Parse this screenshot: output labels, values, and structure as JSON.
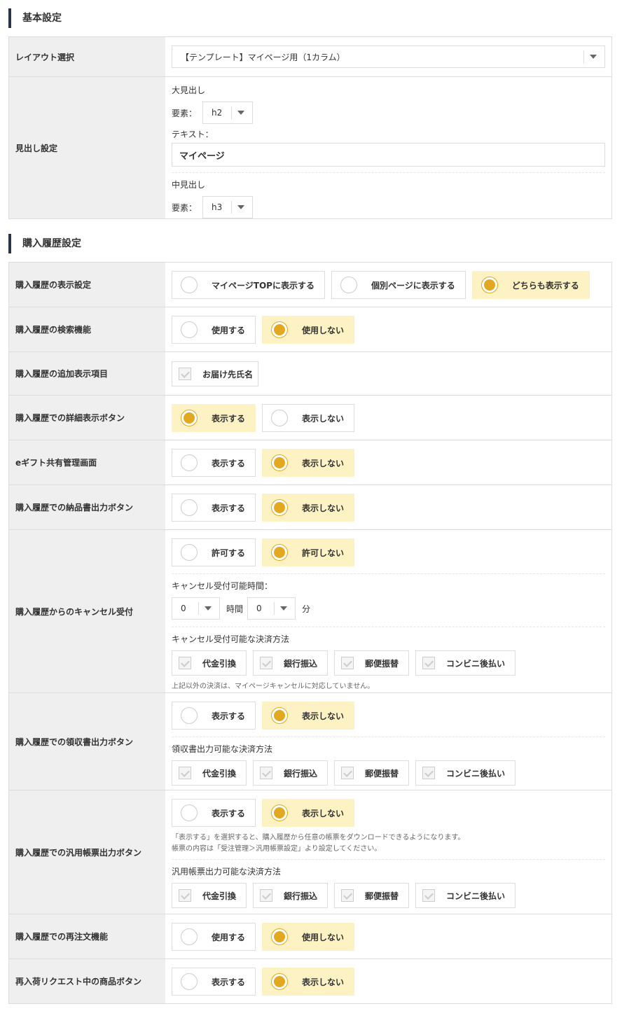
{
  "basic": {
    "title": "基本設定",
    "layout_label": "レイアウト選択",
    "layout_value": "【テンプレート】マイページ用（1カラム）",
    "heading_label": "見出し設定",
    "large_heading": "大見出し",
    "element_label": "要素：",
    "large_element": "h2",
    "text_label": "テキスト：",
    "large_text": "マイページ",
    "mid_heading": "中見出し",
    "mid_element": "h3"
  },
  "history": {
    "title": "購入履歴設定",
    "display_setting": {
      "label": "購入履歴の表示設定",
      "options": [
        "マイページTOPに表示する",
        "個別ページに表示する",
        "どちらも表示する"
      ]
    },
    "search": {
      "label": "購入履歴の検索機能",
      "options": [
        "使用する",
        "使用しない"
      ]
    },
    "additional": {
      "label": "購入履歴の追加表示項目",
      "checkbox": "お届け先氏名"
    },
    "detail_btn": {
      "label": "購入履歴での詳細表示ボタン",
      "options": [
        "表示する",
        "表示しない"
      ]
    },
    "egift": {
      "label": "eギフト共有管理画面",
      "options": [
        "表示する",
        "表示しない"
      ]
    },
    "delivery_btn": {
      "label": "購入履歴での納品書出力ボタン",
      "options": [
        "表示する",
        "表示しない"
      ]
    },
    "cancel": {
      "label": "購入履歴からのキャンセル受付",
      "options": [
        "許可する",
        "許可しない"
      ],
      "time_label": "キャンセル受付可能時間：",
      "hours": "0",
      "hours_unit": "時間",
      "minutes": "0",
      "minutes_unit": "分",
      "methods_label": "キャンセル受付可能な決済方法",
      "methods": [
        "代金引換",
        "銀行振込",
        "郵便振替",
        "コンビニ後払い"
      ],
      "note": "上記以外の決済は、マイページキャンセルに対応していません。"
    },
    "receipt": {
      "label": "購入履歴での領収書出力ボタン",
      "options": [
        "表示する",
        "表示しない"
      ],
      "methods_label": "領収書出力可能な決済方法",
      "methods": [
        "代金引換",
        "銀行振込",
        "郵便振替",
        "コンビニ後払い"
      ]
    },
    "general": {
      "label": "購入履歴での汎用帳票出力ボタン",
      "options": [
        "表示する",
        "表示しない"
      ],
      "note1": "「表示する」を選択すると、購入履歴から任意の帳票をダウンロードできるようになります。",
      "note2": "帳票の内容は「受注管理＞汎用帳票設定」より設定してください。",
      "methods_label": "汎用帳票出力可能な決済方法",
      "methods": [
        "代金引換",
        "銀行振込",
        "郵便振替",
        "コンビニ後払い"
      ]
    },
    "reorder": {
      "label": "購入履歴での再注文機能",
      "options": [
        "使用する",
        "使用しない"
      ]
    },
    "restock": {
      "label": "再入荷リクエスト中の商品ボタン",
      "options": [
        "表示する",
        "表示しない"
      ]
    }
  },
  "colors": {
    "accent": "#e2a81f",
    "selected_bg": "#fdf2c3",
    "header_bg": "#efefef"
  }
}
